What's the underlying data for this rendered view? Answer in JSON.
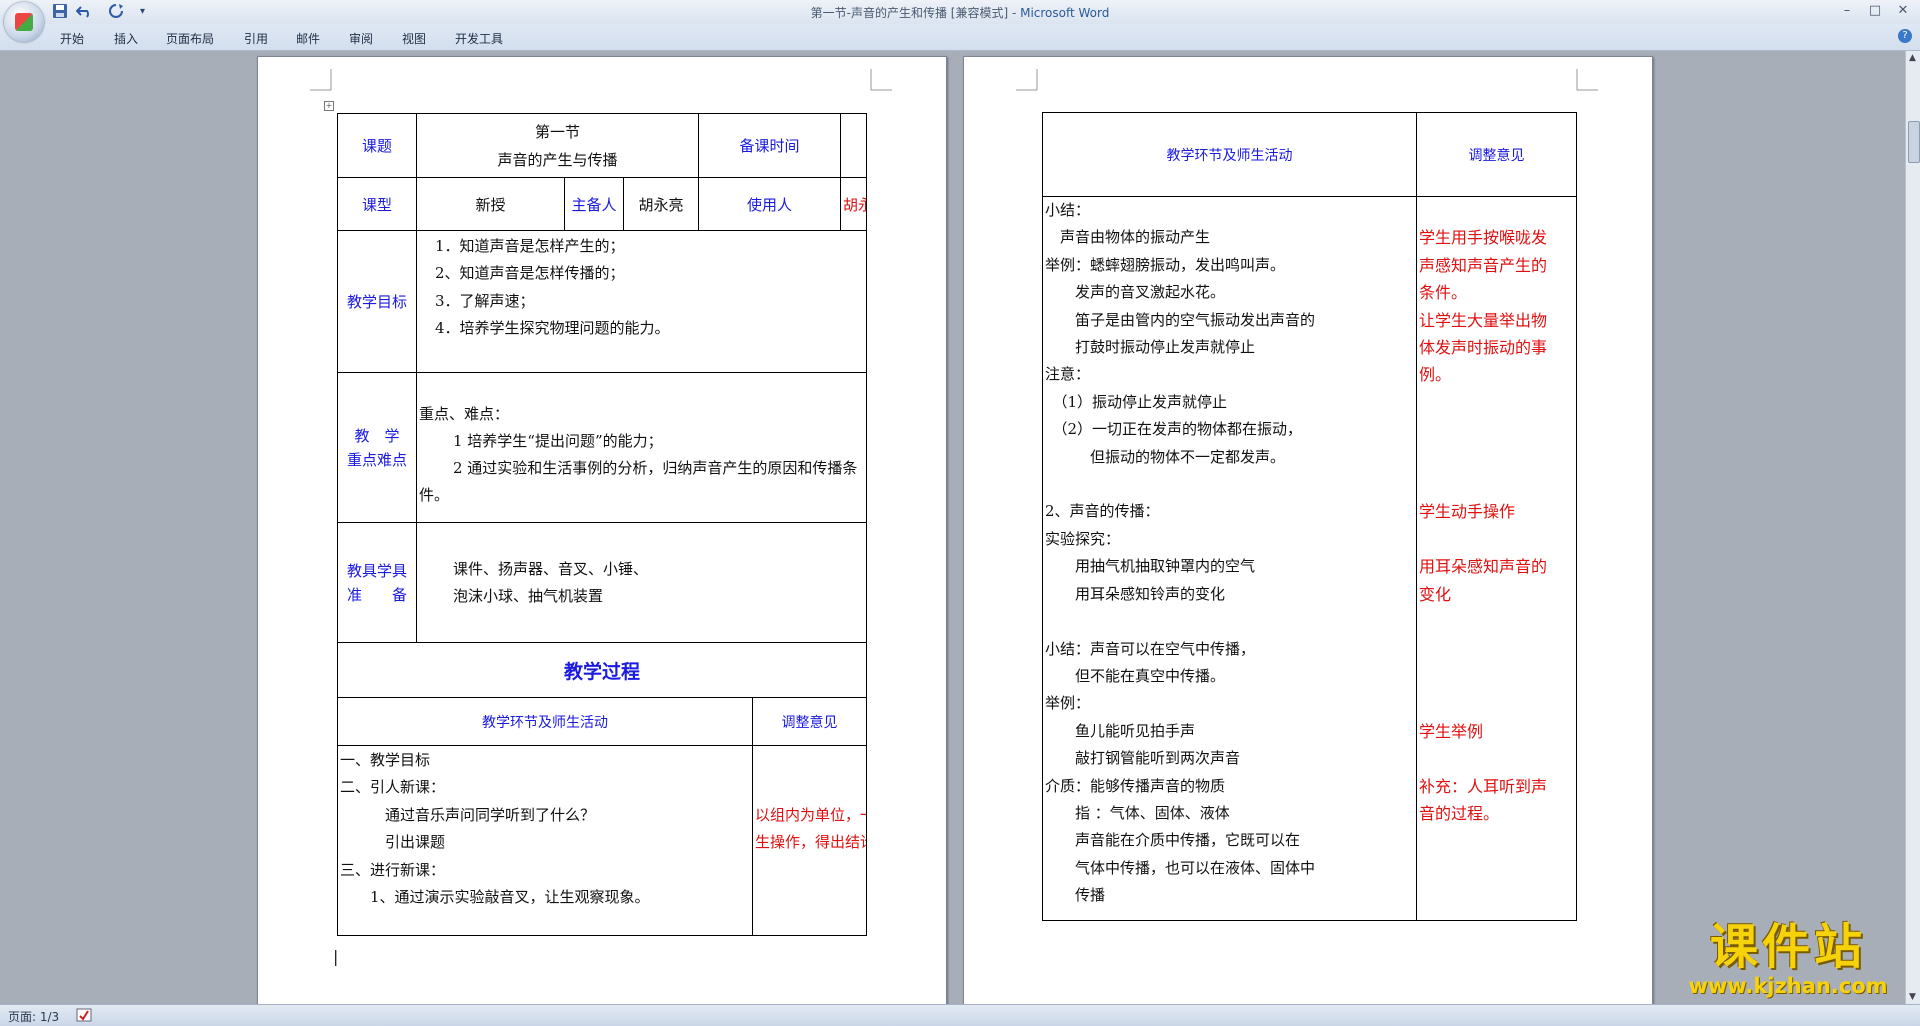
{
  "window": {
    "title": "第一节-声音的产生和传播 [兼容模式] - ",
    "app_name": "Microsoft Word",
    "minimize": "–",
    "maximize": "□",
    "close": "✕"
  },
  "quick_access": {
    "save_icon": "save-icon",
    "undo_icon": "undo-icon",
    "redo_icon": "redo-icon",
    "more": "▾"
  },
  "ribbon": {
    "tabs": [
      "开始",
      "插入",
      "页面布局",
      "引用",
      "邮件",
      "审阅",
      "视图",
      "开发工具"
    ],
    "help": "?"
  },
  "page1": {
    "lesson_title_label": "课题",
    "lesson_title_line1": "第一节",
    "lesson_title_line2": "声音的产生与传播",
    "prep_time_label": "备课时间",
    "type_label": "课型",
    "type_value": "新授",
    "preparer_label": "主备人",
    "preparer_value": "胡永亮",
    "user_label": "使用人",
    "user_value": "胡永亮",
    "goals_label": "教学目标",
    "goals": [
      "1．知道声音是怎样产生的；",
      "2、知道声音是怎样传播的；",
      "3．了解声速；",
      "4．培养学生探究物理问题的能力。"
    ],
    "key_label_1": "教　学",
    "key_label_2": "重点难点",
    "key_title": "重点、难点：",
    "key_items": [
      "1 培养学生“提出问题”的能力；",
      "2 通过实验和生活事例的分析，归纳声音产生的原因和传播条件。"
    ],
    "tools_label_1": "教具学具",
    "tools_label_2": "准　　备",
    "tools_line1": "课件、扬声器、音叉、小锤、",
    "tools_line2": "泡沫小球、抽气机装置",
    "process_title": "教学过程",
    "col_activity": "教学环节及师生活动",
    "col_adjust": "调整意见",
    "activities": [
      "一、教学目标",
      "二、引人新课：",
      "　　　通过音乐声问同学听到了什么？",
      "　　　引出课题",
      "三、进行新课：",
      "　　1、通过演示实验敲音叉，让生观察现象。"
    ],
    "adjust_line1": "以组内为单位，一",
    "adjust_line2": "生操作，得出结论。"
  },
  "page2": {
    "col_activity": "教学环节及师生活动",
    "col_adjust": "调整意见",
    "activities": [
      "小结：",
      "　声音由物体的振动产生",
      "举例：蟋蟀翅膀振动，发出鸣叫声。",
      "　　发声的音叉激起水花。",
      "　　笛子是由管内的空气振动发出声音的",
      "　　打鼓时振动停止发声就停止",
      "注意：",
      "　（1）振动停止发声就停止",
      "　（2）一切正在发声的物体都在振动，",
      "　　　但振动的物体不一定都发声。",
      "",
      "2、声音的传播：",
      "实验探究：",
      "　　用抽气机抽取钟罩内的空气",
      "　　用耳朵感知铃声的变化",
      "",
      "小结：声音可以在空气中传播，",
      "　　但不能在真空中传播。",
      "举例：",
      "　　鱼儿能听见拍手声",
      "　　敲打钢管能听到两次声音",
      "介质：能够传播声音的物质",
      "　　指 ：气体、固体、液体",
      "　　声音能在介质中传播，它既可以在",
      "　　气体中传播，也可以在液体、固体中",
      "　　传播"
    ],
    "adjust": [
      "",
      "学生用手按喉咙发",
      "声感知声音产生的",
      "条件。",
      "让学生大量举出物",
      "体发声时振动的事",
      "例。",
      "",
      "",
      "",
      "",
      "学生动手操作",
      "",
      "用耳朵感知声音的",
      "变化",
      "",
      "",
      "",
      "",
      "学生举例",
      "",
      "补充：人耳听到声",
      "音的过程。",
      "",
      "",
      ""
    ]
  },
  "statusbar": {
    "page_info": "页面: 1/3"
  },
  "watermark": {
    "title": "课件站",
    "url": "www.kjzhan.com"
  },
  "colors": {
    "label_blue": "#1a1ae0",
    "note_red": "#e01010",
    "watermark_yellow": "#f5d20a"
  }
}
